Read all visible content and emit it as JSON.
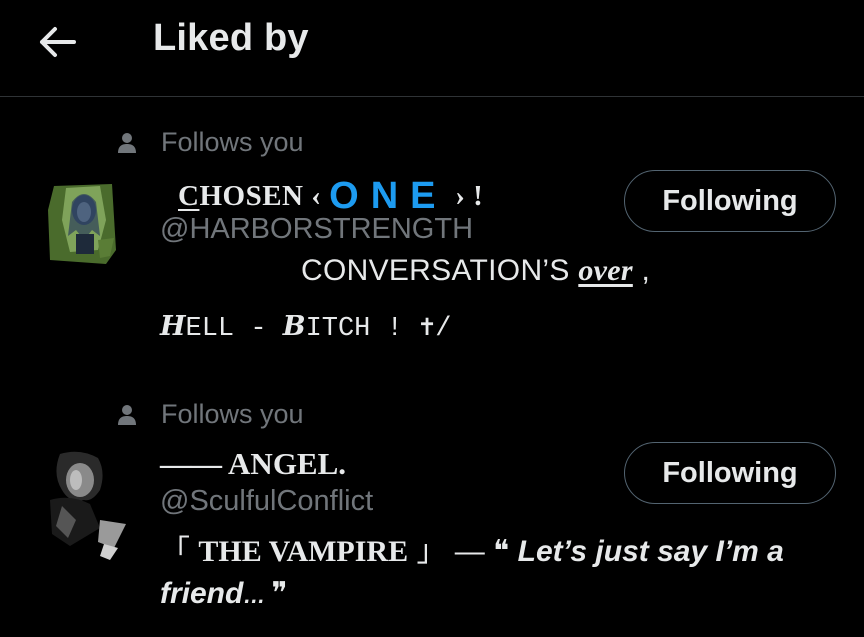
{
  "header": {
    "title": "Liked by",
    "back_icon": "arrow-left-icon"
  },
  "users": [
    {
      "follows_you": "Follows you",
      "display_name": {
        "part1": "C",
        "part2": "HOSEN",
        "part3": " ‹ ",
        "one": "ONE",
        "part4": " › !"
      },
      "handle": "@HARBORSTRENGTH",
      "bio_line1": {
        "text": "CONVERSATION’S ",
        "over": "over",
        "tail": " ,"
      },
      "bio_line2": {
        "h": "H",
        "ell": "ELL - ",
        "b": "B",
        "itch": "ITCH ! ",
        "cross": "✝",
        "slash": "/"
      },
      "button_label": "Following"
    },
    {
      "follows_you": "Follows you",
      "display_name": "—— ANGEL.",
      "handle": "@SculfulConflict",
      "bio_line1": {
        "open_bracket": "「 ",
        "vampire": "THE VAMPIRE",
        "close_bracket": " 」",
        "dash": " — ",
        "open_quote": "❝",
        "quote": " Let’s just say I’m a"
      },
      "bio_line2": {
        "quote": "friend",
        "ellipsis": "… ",
        "close_quote": "❞"
      },
      "button_label": "Following"
    }
  ],
  "colors": {
    "background": "#000000",
    "text": "#e7e9ea",
    "secondary": "#71767b",
    "accent": "#1d9bf0",
    "border": "#2f3336",
    "button_border": "#536471"
  }
}
